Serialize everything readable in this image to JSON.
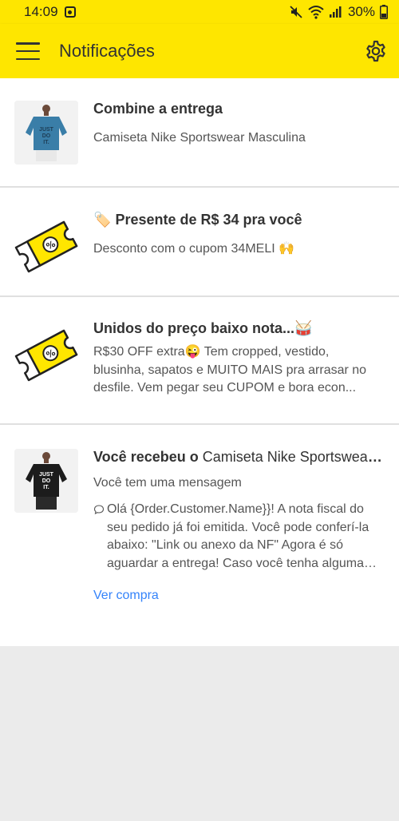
{
  "statusbar": {
    "time": "14:09",
    "battery": "30%"
  },
  "appbar": {
    "title": "Notificações"
  },
  "notifications": [
    {
      "title": "Combine a entrega",
      "subtitle": "Camiseta Nike Sportswear Masculina",
      "image": "blue-nike-tshirt"
    },
    {
      "emoji": "🏷️",
      "title": "Presente de R$ 34 pra você",
      "subtitle": "Desconto com o cupom 34MELI 🙌",
      "icon": "coupon-ticket-icon"
    },
    {
      "title": "Unidos do preço baixo nota...🥁",
      "body": "R$30 OFF extra😜 Tem cropped, vestido, blusinha, sapatos e MUITO MAIS pra arrasar no desfile. Vem pegar seu CUPOM e bora econ...",
      "icon": "coupon-ticket-icon"
    },
    {
      "title_bold": "Você recebeu o",
      "title_normal": " Camiseta Nike Sportswear Masculina",
      "subtitle": "Você tem uma mensagem",
      "message": "Olá {Order.Customer.Name}}! A nota fiscal do seu pedido já foi emitida. Você pode conferí-la abaixo: \"Link ou anexo da NF\" Agora é só aguardar a entrega! Caso você tenha alguma dúvida ou problema com o seu pedido, por favor entre em contato.",
      "link": "Ver compra",
      "image": "black-nike-tshirt"
    }
  ],
  "colors": {
    "brand_yellow": "#fee600",
    "link_blue": "#3483fa",
    "coupon_yellow": "#ffe600",
    "background": "#ebebeb"
  }
}
